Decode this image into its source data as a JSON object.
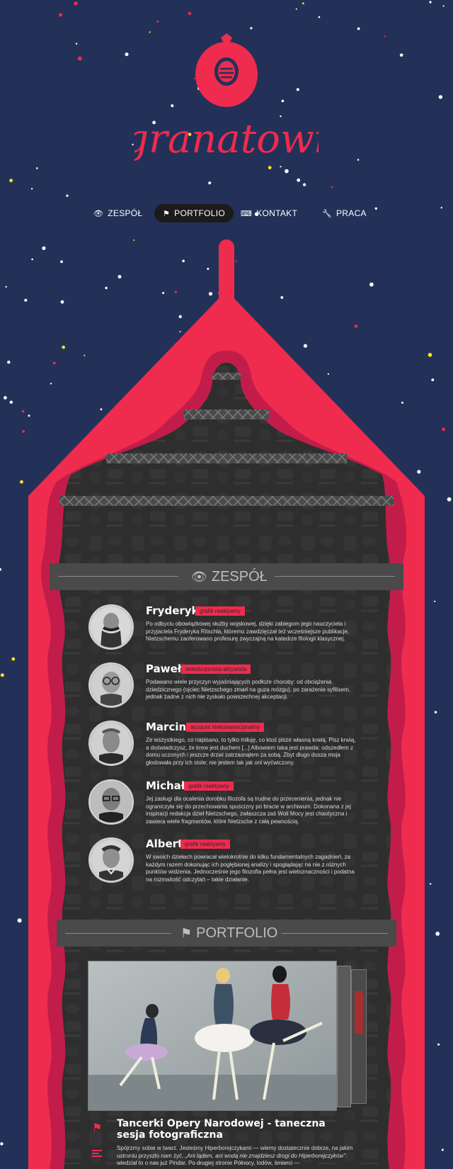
{
  "brand": {
    "logo_text": "granatowi"
  },
  "colors": {
    "background": "#233159",
    "accent": "#ef2b4e",
    "dark_accent": "#c21d4a",
    "panel": "#2f2f2f"
  },
  "nav": {
    "items": [
      {
        "label": "ZESPÓŁ",
        "icon": "eye-icon"
      },
      {
        "label": "PORTFOLIO",
        "icon": "flag-icon",
        "active": true
      },
      {
        "label": "KONTAKT",
        "icon": "keyboard-icon"
      },
      {
        "label": "PRACA",
        "icon": "wrench-icon"
      }
    ]
  },
  "team": {
    "title": "ZESPÓŁ",
    "members": [
      {
        "name": "Fryderyk",
        "role": "grafik reaktywny",
        "desc": "Po odbyciu obowiązkowej służby wojskowej, dzięki zabiegom jego nauczyciela i przyjaciela Fryderyka Ritschla, któremu zawdzięczał też wcześniejsze publikacje, Nietzschemu zaoferowano profesurę zwyczajną na katedrze filologii klasycznej."
      },
      {
        "name": "Paweł",
        "role": "rewolucjonista-aktywista",
        "desc": "Podawano wiele przyczyn wyjaśniających podłoże choroby: od obciążenia dziedzicznego (ojciec Nietzschego zmarł na guza mózgu), po zarażenie syfilisem, jednak żadne z nich nie zyskało powszechnej akceptacji."
      },
      {
        "name": "Marcin",
        "role": "account niekonwencjonalny",
        "desc": "Ze wszystkiego, co napisano, to tylko miłuję, co ktoś pisze własną krwią. Pisz krwią, a doświadczysz, że krew jest duchem [...] Albowiem taka jest prawda: odszedłem z domu uczonych i jeszcze drzwi zatrzasnąłem za sobą. Zbyt długo dusza moja głodowała przy ich stole; nie jestem tak jak oni wyćwiczony."
      },
      {
        "name": "Michał",
        "role": "grafik reaktywny",
        "desc": "Jej zasługi dla ocalenia dorobku filozofa są trudne do przecenienia, jednak nie ograniczyła się do przechowania spuścizny po bracie w archiwum. Dokonana z jej inspiracji redakcja dzieł Nietzschego, zwłaszcza zaś Woli Mocy jest chaotyczna i zawiera wiele fragmentów, które Nietzsche z całą pewnością."
      },
      {
        "name": "Albert",
        "role": "grafik reaktywny",
        "desc": "W swoich dziełach powracał wielokrotnie do kilku fundamentalnych zagadnień, za każdym razem dokonując ich pogłębionej analizy i spoglądając na nie z różnych punktów widzenia. Jednocześnie jego filozofia pełna jest wieloznaczności i podatna na rozmaitość odczytań – takie działanie."
      }
    ]
  },
  "portfolio": {
    "title": "PORTFOLIO",
    "item": {
      "title": "Tancerki Opery Narodowej - taneczna sesja fotograficzna",
      "desc_start": "Spójrzmy sobie w twarz. Jesteśmy Hiperborejczykami — wiemy dostatecznie dobrze, na jakim ustroniu przyszło nam żyć. ",
      "desc_quote": "„Ani lądem, ani wodą nie znajdziesz drogi do Hiperborejczyków”",
      "desc_end": ": wiedział to o nas już Pindar. Po drugiej stronie Północy, lodów, śmierci —"
    }
  }
}
